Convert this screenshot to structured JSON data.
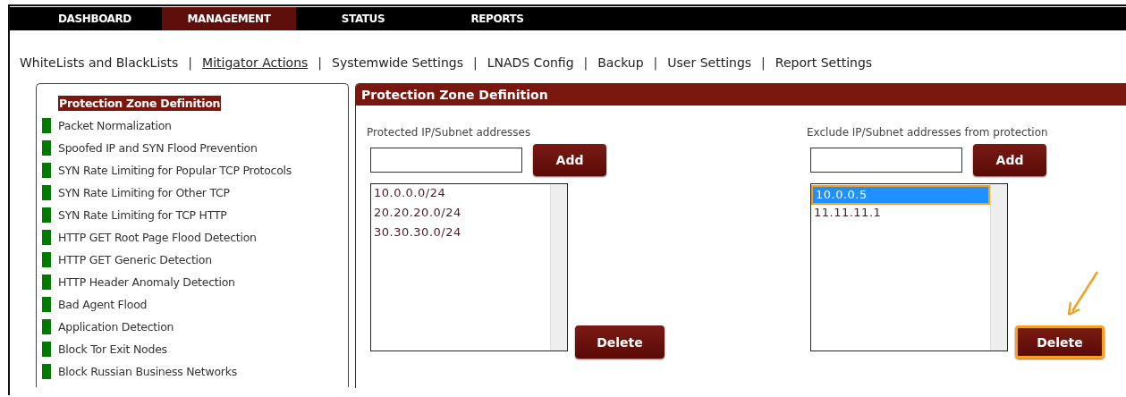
{
  "top_nav": [
    {
      "label": "DASHBOARD",
      "selected": false
    },
    {
      "label": "MANAGEMENT",
      "selected": true
    },
    {
      "label": "STATUS",
      "selected": false
    },
    {
      "label": "REPORTS",
      "selected": false
    }
  ],
  "sub_nav": [
    {
      "label": "WhiteLists and BlackLists",
      "selected": false
    },
    {
      "label": "Mitigator Actions",
      "selected": true
    },
    {
      "label": "Systemwide Settings",
      "selected": false
    },
    {
      "label": "LNADS Config",
      "selected": false
    },
    {
      "label": "Backup",
      "selected": false
    },
    {
      "label": "User Settings",
      "selected": false
    },
    {
      "label": "Report Settings",
      "selected": false
    }
  ],
  "sub_nav_separator": "|",
  "sidebar": {
    "items": [
      {
        "label": "Protection Zone Definition",
        "selected": true
      },
      {
        "label": "Packet Normalization",
        "selected": false
      },
      {
        "label": "Spoofed IP and SYN Flood Prevention",
        "selected": false
      },
      {
        "label": "SYN Rate Limiting for Popular TCP Protocols",
        "selected": false
      },
      {
        "label": "SYN Rate Limiting for Other TCP",
        "selected": false
      },
      {
        "label": "SYN Rate Limiting for TCP HTTP",
        "selected": false
      },
      {
        "label": "HTTP GET Root Page Flood Detection",
        "selected": false
      },
      {
        "label": "HTTP GET Generic Detection",
        "selected": false
      },
      {
        "label": "HTTP Header Anomaly Detection",
        "selected": false
      },
      {
        "label": "Bad Agent Flood",
        "selected": false
      },
      {
        "label": "Application Detection",
        "selected": false
      },
      {
        "label": "Block Tor Exit Nodes",
        "selected": false
      },
      {
        "label": "Block Russian Business Networks",
        "selected": false
      }
    ]
  },
  "panel": {
    "title": "Protection Zone Definition",
    "columns": [
      {
        "label": "Protected IP/Subnet addresses",
        "add_button": "Add",
        "delete_button": {
          "label": "Delete",
          "highlighted": false
        },
        "addresses": [
          {
            "text": "10.0.0.0/24",
            "selected": false
          },
          {
            "text": "20.20.20.0/24",
            "selected": false
          },
          {
            "text": "30.30.30.0/24",
            "selected": false
          }
        ]
      },
      {
        "label": "Exclude IP/Subnet addresses from protection",
        "add_button": "Add",
        "delete_button": {
          "label": "Delete",
          "highlighted": true
        },
        "addresses": [
          {
            "text": "10.0.0.5",
            "selected": true
          },
          {
            "text": "11.11.11.1",
            "selected": false
          }
        ]
      }
    ]
  }
}
